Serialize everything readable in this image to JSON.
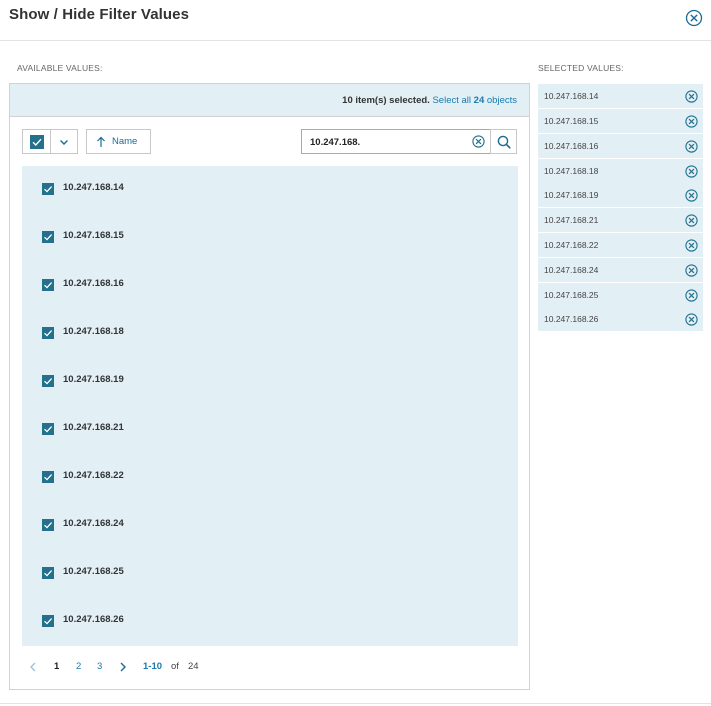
{
  "dialog": {
    "title": "Show / Hide Filter Values",
    "close_icon": "close-circle-icon"
  },
  "available": {
    "label": "AVAILABLE VALUES:",
    "status": {
      "count_text": "10 item(s) selected.",
      "select_all_prefix": "Select all",
      "select_all_count": "24",
      "select_all_suffix": "objects"
    },
    "toolbar": {
      "sort_label": "Name",
      "sort_icon": "arrow-up-icon",
      "dropdown_icon": "chevron-down-icon",
      "search_value": "10.247.168.",
      "search_icon": "search-icon",
      "clear_icon": "clear-circle-icon"
    },
    "items": [
      {
        "label": "10.247.168.14",
        "checked": true
      },
      {
        "label": "10.247.168.15",
        "checked": true
      },
      {
        "label": "10.247.168.16",
        "checked": true
      },
      {
        "label": "10.247.168.18",
        "checked": true
      },
      {
        "label": "10.247.168.19",
        "checked": true
      },
      {
        "label": "10.247.168.21",
        "checked": true
      },
      {
        "label": "10.247.168.22",
        "checked": true
      },
      {
        "label": "10.247.168.24",
        "checked": true
      },
      {
        "label": "10.247.168.25",
        "checked": true
      },
      {
        "label": "10.247.168.26",
        "checked": true
      }
    ],
    "pager": {
      "pages": [
        "1",
        "2",
        "3"
      ],
      "current_page": "1",
      "range": "1-10",
      "of": "of",
      "total": "24"
    }
  },
  "selected": {
    "label": "SELECTED VALUES:",
    "items": [
      "10.247.168.14",
      "10.247.168.15",
      "10.247.168.16",
      "10.247.168.18",
      "10.247.168.19",
      "10.247.168.21",
      "10.247.168.22",
      "10.247.168.24",
      "10.247.168.25",
      "10.247.168.26"
    ]
  },
  "colors": {
    "accent": "#1a7bb0",
    "checkbox": "#23718c",
    "list_bg": "#e2eff5",
    "search_border": "#e1a23c"
  }
}
